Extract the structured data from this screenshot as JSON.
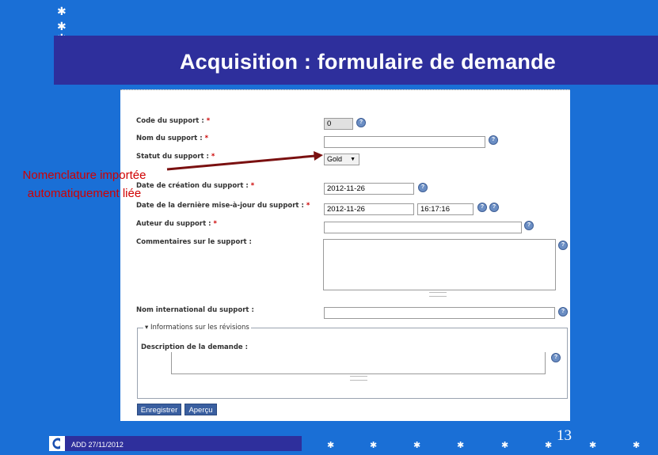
{
  "slide": {
    "title": "Acquisition : formulaire de demande",
    "annotation_line1": "Nomenclature importée",
    "annotation_line2": "automatiquement liée",
    "footer": "ADD 27/11/2012",
    "page_number": "13",
    "colors": {
      "background": "#1a6fd6",
      "title_bar": "#2e2f9c",
      "annotation": "#d00000"
    }
  },
  "form": {
    "code_label": "Code du support : ",
    "code_value": "0",
    "nom_label": "Nom du support : ",
    "nom_value": "",
    "statut_label": "Statut du support : ",
    "statut_value": "Gold",
    "date_creation_label": "Date de création du support : ",
    "date_creation_value": "2012-11-26",
    "date_maj_label": "Date de la dernière mise-à-jour du support : ",
    "date_maj_value": "2012-11-26",
    "time_maj_value": "16:17:16",
    "auteur_label": "Auteur du support : ",
    "auteur_value": "",
    "commentaires_label": "Commentaires sur le support :",
    "nom_international_label": "Nom international du support :",
    "revisions_legend": "Informations sur les révisions",
    "description_label": "Description de la demande :",
    "required_mark": "*",
    "help_glyph": "?",
    "save_button": "Enregistrer",
    "preview_button": "Aperçu"
  }
}
